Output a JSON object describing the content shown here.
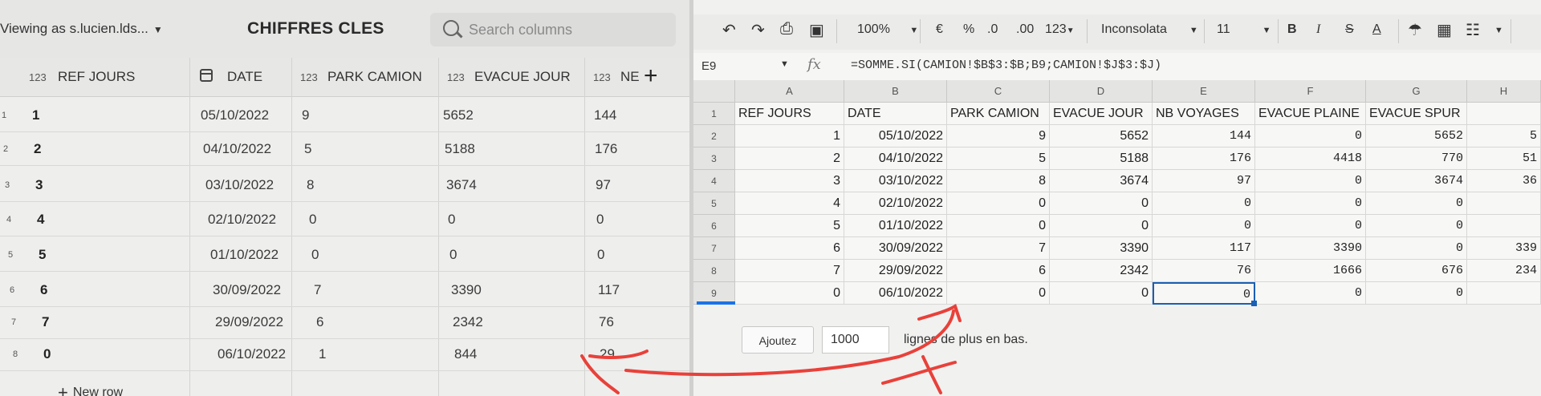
{
  "left_app": {
    "viewing_as": "Viewing as s.lucien.lds...",
    "title": "CHIFFRES CLES",
    "search_placeholder": "Search columns",
    "columns": [
      {
        "type": "123",
        "label": "REF JOURS"
      },
      {
        "type": "date",
        "label": "DATE"
      },
      {
        "type": "123",
        "label": "PARK CAMION"
      },
      {
        "type": "123",
        "label": "EVACUE JOUR"
      },
      {
        "type": "123",
        "label": "NE"
      }
    ],
    "rows": [
      {
        "idx": "1",
        "ref": "1",
        "date": "05/10/2022",
        "park": "9",
        "evacue": "5652",
        "nb": "144"
      },
      {
        "idx": "2",
        "ref": "2",
        "date": "04/10/2022",
        "park": "5",
        "evacue": "5188",
        "nb": "176"
      },
      {
        "idx": "3",
        "ref": "3",
        "date": "03/10/2022",
        "park": "8",
        "evacue": "3674",
        "nb": "97"
      },
      {
        "idx": "4",
        "ref": "4",
        "date": "02/10/2022",
        "park": "0",
        "evacue": "0",
        "nb": "0"
      },
      {
        "idx": "5",
        "ref": "5",
        "date": "01/10/2022",
        "park": "0",
        "evacue": "0",
        "nb": "0"
      },
      {
        "idx": "6",
        "ref": "6",
        "date": "30/09/2022",
        "park": "7",
        "evacue": "3390",
        "nb": "117"
      },
      {
        "idx": "7",
        "ref": "7",
        "date": "29/09/2022",
        "park": "6",
        "evacue": "2342",
        "nb": "76"
      },
      {
        "idx": "8",
        "ref": "0",
        "date": "06/10/2022",
        "park": "1",
        "evacue": "844",
        "nb": "29"
      }
    ],
    "new_row_label": "New row"
  },
  "sheet": {
    "toolbar": {
      "zoom": "100%",
      "currency": "€",
      "percent": "%",
      "dec_less": ".0",
      "dec_more": ".00",
      "format": "123",
      "font": "Inconsolata",
      "font_size": "11",
      "bold": "B",
      "italic": "I",
      "strike": "S",
      "text_color": "A"
    },
    "name_box": "E9",
    "fx": "fx",
    "formula": "=SOMME.SI(CAMION!$B$3:$B;B9;CAMION!$J$3:$J)",
    "col_letters": [
      "A",
      "B",
      "C",
      "D",
      "E",
      "F",
      "G",
      "H"
    ],
    "row_numbers": [
      "1",
      "2",
      "3",
      "4",
      "5",
      "6",
      "7",
      "8",
      "9"
    ],
    "header_row": [
      "REF JOURS",
      "DATE",
      "PARK CAMION",
      "EVACUE JOUR",
      "NB VOYAGES",
      "EVACUE PLAINE",
      "EVACUE SPUR",
      ""
    ],
    "data_rows": [
      [
        "1",
        "05/10/2022",
        "9",
        "5652",
        "144",
        "0",
        "5652",
        "5"
      ],
      [
        "2",
        "04/10/2022",
        "5",
        "5188",
        "176",
        "4418",
        "770",
        "51"
      ],
      [
        "3",
        "03/10/2022",
        "8",
        "3674",
        "97",
        "0",
        "3674",
        "36"
      ],
      [
        "4",
        "02/10/2022",
        "0",
        "0",
        "0",
        "0",
        "0",
        ""
      ],
      [
        "5",
        "01/10/2022",
        "0",
        "0",
        "0",
        "0",
        "0",
        ""
      ],
      [
        "6",
        "30/09/2022",
        "7",
        "3390",
        "117",
        "3390",
        "0",
        "339"
      ],
      [
        "7",
        "29/09/2022",
        "6",
        "2342",
        "76",
        "1666",
        "676",
        "234"
      ],
      [
        "0",
        "06/10/2022",
        "0",
        "0",
        "0",
        "0",
        "0",
        ""
      ]
    ],
    "add_button": "Ajoutez",
    "add_count": "1000",
    "add_suffix": "lignes de plus en bas."
  },
  "colors": {
    "annotation": "#e8413a",
    "selection": "#1a5fb4"
  }
}
